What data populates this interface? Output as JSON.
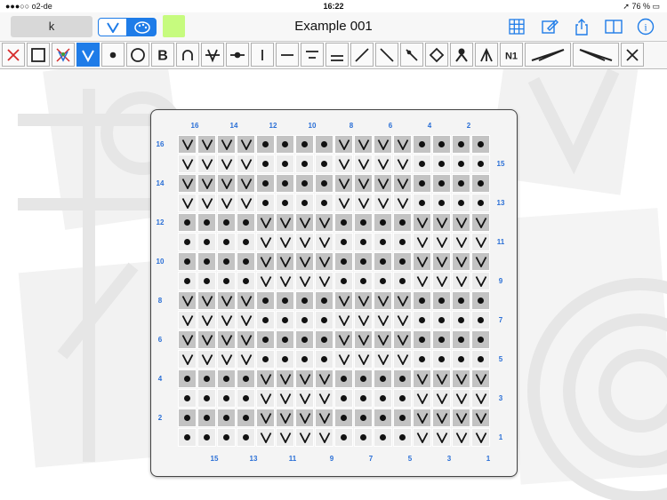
{
  "status_bar": {
    "carrier": "●●●○○ o2-de",
    "time": "16:22",
    "battery": "76 %"
  },
  "nav": {
    "symbol_field": "k",
    "title": "Example 001",
    "swatch_color": "#c6fb7e",
    "segment_icons": [
      "knit-v-icon",
      "palette-icon"
    ],
    "right_icons": [
      "grid-add-icon",
      "edit-icon",
      "share-icon",
      "book-icon",
      "info-icon"
    ]
  },
  "accent_color": "#1e7ce8",
  "toolbar": {
    "tools": [
      {
        "name": "delete",
        "icon": "x-icon"
      },
      {
        "name": "empty",
        "icon": "square-icon"
      },
      {
        "name": "no-stitch",
        "icon": "no-stitch-icon"
      },
      {
        "name": "knit",
        "icon": "v-icon",
        "selected": true
      },
      {
        "name": "purl",
        "icon": "dot-icon"
      },
      {
        "name": "yarn-over",
        "icon": "circle-icon"
      },
      {
        "name": "twisted",
        "icon": "b-icon",
        "text": "B"
      },
      {
        "name": "cap",
        "icon": "cap-icon"
      },
      {
        "name": "v-bar",
        "icon": "v-bar-icon"
      },
      {
        "name": "dot-bar",
        "icon": "dot-bar-icon"
      },
      {
        "name": "vertical-line",
        "icon": "vertical-line-icon"
      },
      {
        "name": "dash",
        "icon": "dash-icon"
      },
      {
        "name": "double-line",
        "icon": "double-line-icon"
      },
      {
        "name": "line-bottom",
        "icon": "line-bottom-icon"
      },
      {
        "name": "slash-right",
        "icon": "slash-right-icon"
      },
      {
        "name": "slash-left",
        "icon": "slash-left-icon"
      },
      {
        "name": "slash-dot",
        "icon": "slash-dot-icon"
      },
      {
        "name": "diamond",
        "icon": "diamond-icon"
      },
      {
        "name": "person",
        "icon": "person-icon"
      },
      {
        "name": "lambda",
        "icon": "lambda-icon"
      },
      {
        "name": "n1",
        "icon": "n1-icon",
        "text": "N1"
      },
      {
        "name": "cable-right",
        "icon": "cable-right-icon"
      },
      {
        "name": "cable-left",
        "icon": "cable-left-icon"
      },
      {
        "name": "more",
        "icon": "partial-x-icon"
      }
    ]
  },
  "chart": {
    "top_labels": [
      "16",
      "14",
      "12",
      "10",
      "8",
      "6",
      "4",
      "2"
    ],
    "bottom_labels": [
      "15",
      "13",
      "11",
      "9",
      "7",
      "5",
      "3",
      "1"
    ],
    "left_labels": [
      "16",
      "14",
      "12",
      "10",
      "8",
      "6",
      "4",
      "2"
    ],
    "right_labels": [
      "15",
      "13",
      "11",
      "9",
      "7",
      "5",
      "3",
      "1"
    ],
    "rows": [
      "VVVV••••VVVV••••",
      "VVVV••••VVVV••••",
      "VVVV••••VVVV••••",
      "VVVV••••VVVV••••",
      "••••VVVV••••VVVV",
      "••••VVVV••••VVVV",
      "••••VVVV••••VVVV",
      "••••VVVV••••VVVV",
      "VVVV••••VVVV••••",
      "VVVV••••VVVV••••",
      "VVVV••••VVVV••••",
      "VVVV••••VVVV••••",
      "••••VVVV••••VVVV",
      "••••VVVV••••VVVV",
      "••••VVVV••••VVVV",
      "••••VVVV••••VVVV"
    ]
  }
}
